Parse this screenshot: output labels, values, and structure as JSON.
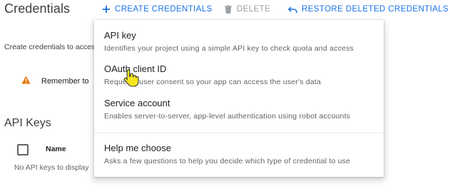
{
  "page": {
    "title": "Credentials"
  },
  "toolbar": {
    "create_label": "CREATE CREDENTIALS",
    "delete_label": "DELETE",
    "restore_label": "RESTORE DELETED CREDENTIALS",
    "accent_color": "#1a73e8",
    "disabled_color": "#9aa0a6"
  },
  "main": {
    "intro_text": "Create credentials to access your enabled APIs",
    "warning_text": "Remember to configure the OAuth consent screen",
    "warning_color": "#e37400",
    "api_keys_title": "API Keys",
    "table": {
      "columns": [
        "Name"
      ],
      "empty_text": "No API keys to display"
    }
  },
  "menu": {
    "items": [
      {
        "title": "API key",
        "description": "Identifies your project using a simple API key to check quota and access"
      },
      {
        "title": "OAuth client ID",
        "description": "Requests user consent so your app can access the user's data"
      },
      {
        "title": "Service account",
        "description": "Enables server-to-server, app-level authentication using robot accounts"
      },
      {
        "title": "Help me choose",
        "description": "Asks a few questions to help you decide which type of credential to use"
      }
    ]
  },
  "icons": {
    "create": "plus-icon",
    "delete": "trash-icon",
    "restore": "undo-icon",
    "warning": "warning-icon",
    "cursor": "hand-pointer-icon"
  }
}
